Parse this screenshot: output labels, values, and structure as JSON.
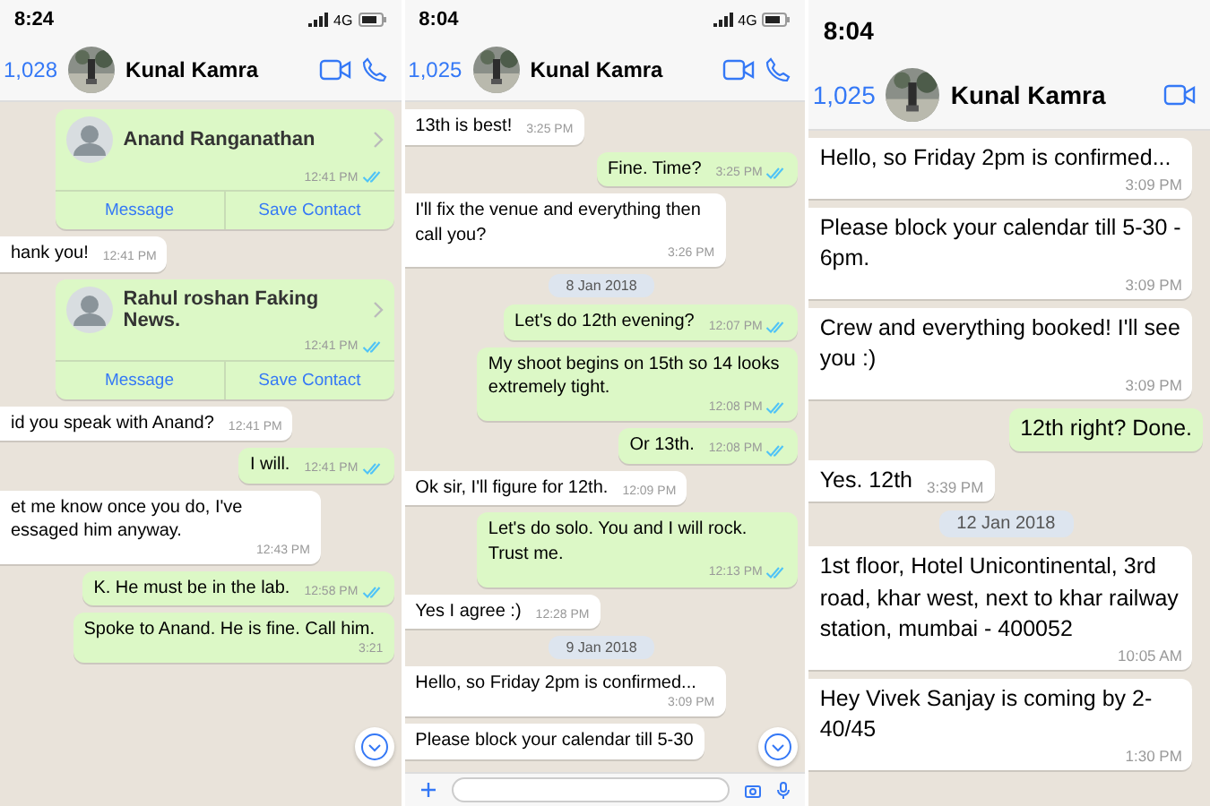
{
  "panels": [
    {
      "status": {
        "time": "8:24",
        "network": "4G"
      },
      "header": {
        "back": "1,028",
        "name": "Kunal Kamra",
        "video": true,
        "call": true
      },
      "input_bar": false,
      "scroll_button": true,
      "messages": [
        {
          "kind": "contact",
          "name": "Anand Ranganathan",
          "time": "12:41 PM",
          "read": true,
          "actions": [
            "Message",
            "Save Contact"
          ]
        },
        {
          "kind": "in",
          "text": "hank you!",
          "time": "12:41 PM"
        },
        {
          "kind": "contact",
          "name": "Rahul roshan Faking News.",
          "time": "12:41 PM",
          "read": true,
          "actions": [
            "Message",
            "Save Contact"
          ]
        },
        {
          "kind": "in",
          "text": "id you speak with Anand?",
          "time": "12:41 PM"
        },
        {
          "kind": "out",
          "text": "I will.",
          "time": "12:41 PM",
          "read": true
        },
        {
          "kind": "in",
          "text": "et me know once you do, I've essaged him anyway.",
          "time": "12:43 PM"
        },
        {
          "kind": "out",
          "text": "K. He must be in the lab.",
          "time": "12:58 PM",
          "read": true
        },
        {
          "kind": "out",
          "text": "Spoke to Anand. He is fine. Call him.",
          "time": "3:21",
          "read": false
        }
      ]
    },
    {
      "status": {
        "time": "8:04",
        "network": "4G"
      },
      "header": {
        "back": "1,025",
        "name": "Kunal Kamra",
        "video": true,
        "call": true
      },
      "input_bar": true,
      "scroll_button": true,
      "messages": [
        {
          "kind": "in",
          "text": "13th is best!",
          "time": "3:25 PM"
        },
        {
          "kind": "out",
          "text": "Fine. Time?",
          "time": "3:25 PM",
          "read": true
        },
        {
          "kind": "in",
          "text": "I'll fix the venue and everything then call you?",
          "time": "3:26 PM"
        },
        {
          "kind": "date",
          "text": "8 Jan 2018"
        },
        {
          "kind": "out",
          "text": "Let's do 12th evening?",
          "time": "12:07 PM",
          "read": true
        },
        {
          "kind": "out",
          "text": "My shoot begins on 15th so 14 looks extremely tight.",
          "time": "12:08 PM",
          "read": true
        },
        {
          "kind": "out",
          "text": "Or 13th.",
          "time": "12:08 PM",
          "read": true
        },
        {
          "kind": "in",
          "text": "Ok sir, I'll figure for 12th.",
          "time": "12:09 PM"
        },
        {
          "kind": "out",
          "text": "Let's do solo. You and I will rock. Trust me.",
          "time": "12:13 PM",
          "read": true
        },
        {
          "kind": "in",
          "text": "Yes I agree :)",
          "time": "12:28 PM"
        },
        {
          "kind": "date",
          "text": "9 Jan 2018"
        },
        {
          "kind": "in",
          "text": "Hello, so Friday 2pm is confirmed...",
          "time": "3:09 PM"
        },
        {
          "kind": "in",
          "text": "Please block your calendar till 5-30"
        }
      ]
    },
    {
      "status": {
        "time": "8:04"
      },
      "header": {
        "back": "1,025",
        "name": "Kunal Kamra",
        "video": true,
        "call": false
      },
      "input_bar": false,
      "scroll_button": false,
      "messages": [
        {
          "kind": "in",
          "text": "Hello, so Friday 2pm is confirmed...",
          "time": "3:09 PM"
        },
        {
          "kind": "in",
          "text": "Please block your calendar till 5-30 - 6pm.",
          "time": "3:09 PM"
        },
        {
          "kind": "in",
          "text": "Crew and everything booked! I'll see you :)",
          "time": "3:09 PM"
        },
        {
          "kind": "out",
          "text": "12th right? Done.",
          "read": false
        },
        {
          "kind": "in",
          "text": "Yes. 12th",
          "time": "3:39 PM"
        },
        {
          "kind": "date",
          "text": "12 Jan 2018"
        },
        {
          "kind": "in",
          "text": "1st floor, Hotel Unicontinental, 3rd road, khar west, next to khar railway station, mumbai - 400052",
          "time": "10:05 AM"
        },
        {
          "kind": "in",
          "text": "Hey Vivek Sanjay is coming by 2-40/45",
          "time": "1:30 PM"
        }
      ]
    }
  ]
}
